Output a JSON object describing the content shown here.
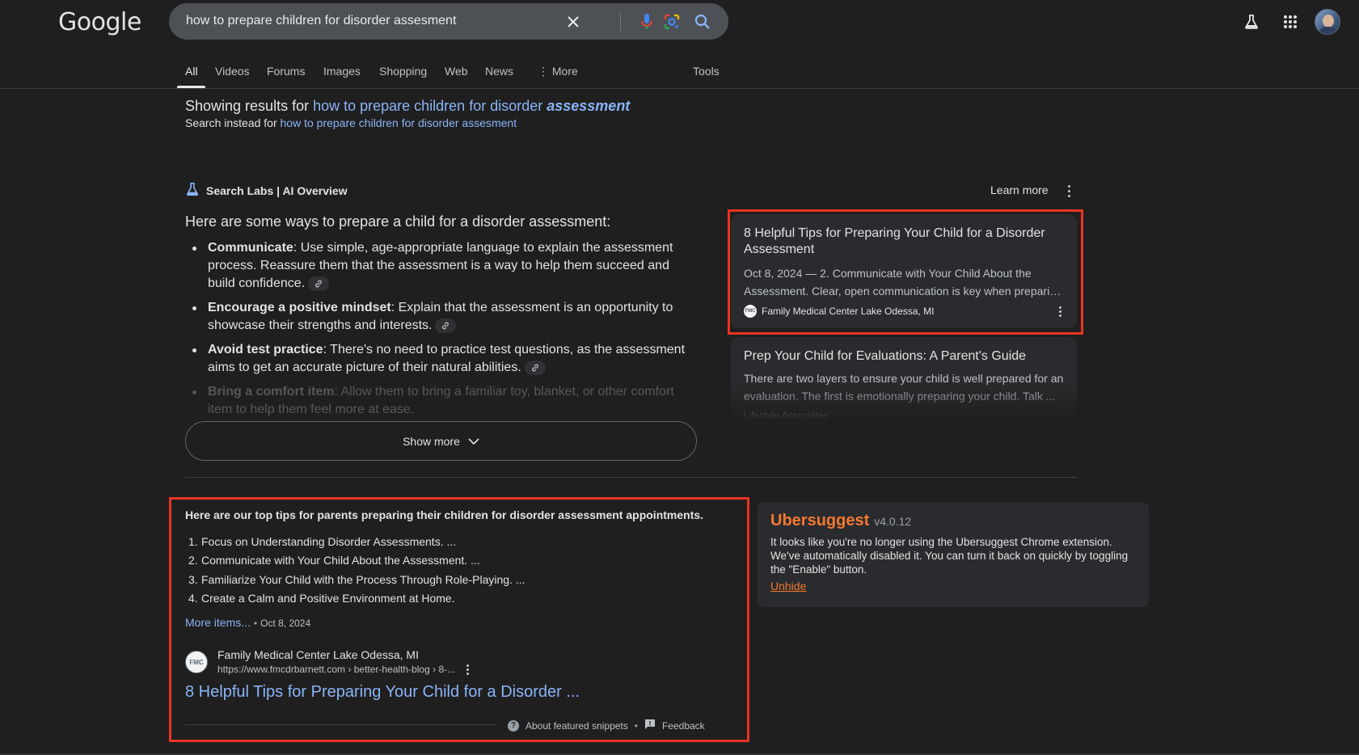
{
  "header": {
    "logo": "Google",
    "search_query": "how to prepare children for disorder assesment"
  },
  "tabs": [
    {
      "label": "All"
    },
    {
      "label": "Videos"
    },
    {
      "label": "Forums"
    },
    {
      "label": "Images"
    },
    {
      "label": "Shopping"
    },
    {
      "label": "Web"
    },
    {
      "label": "News"
    },
    {
      "label": "More"
    },
    {
      "label": "Tools"
    }
  ],
  "spelling": {
    "showing_prefix": "Showing results for ",
    "corrected_plain": "how to prepare children for disorder ",
    "corrected_bold": "assessment",
    "instead_prefix": "Search instead for ",
    "instead_query": "how to prepare children for disorder assesment"
  },
  "ai_overview": {
    "label": "Search Labs | AI Overview",
    "learn_more": "Learn more",
    "heading": "Here are some ways to prepare a child for a disorder assessment:",
    "items": [
      {
        "bold": "Communicate",
        "text": ": Use simple, age-appropriate language to explain the assessment process. Reassure them that the assessment is a way to help them succeed and build confidence."
      },
      {
        "bold": "Encourage a positive mindset",
        "text": ": Explain that the assessment is an opportunity to showcase their strengths and interests."
      },
      {
        "bold": "Avoid test practice",
        "text": ": There's no need to practice test questions, as the assessment aims to get an accurate picture of their natural abilities."
      },
      {
        "bold": "Bring a comfort item",
        "text": ": Allow them to bring a familiar toy, blanket, or other comfort item to help them feel more at ease."
      }
    ],
    "show_more": "Show more",
    "sources": [
      {
        "title": "8 Helpful Tips for Preparing Your Child for a Disorder Assessment",
        "snippet_line1": "Oct 8, 2024 — 2. Communicate with Your Child About the",
        "snippet_line2": "Assessment. Clear, open communication is key when preparin...",
        "site": "Family Medical Center Lake Odessa, MI",
        "favicon_text": "FMC"
      },
      {
        "title": "Prep Your Child for Evaluations: A Parent's Guide",
        "snippet_line1": "There are two layers to ensure your child is well prepared for an",
        "snippet_line2": "evaluation. The first is emotionally preparing your child. Talk ...",
        "site": "Lifestyle Associates"
      }
    ]
  },
  "featured_snippet": {
    "heading": "Here are our top tips for parents preparing their children for disorder assessment appointments.",
    "items": [
      "Focus on Understanding Disorder Assessments. ...",
      "Communicate with Your Child About the Assessment. ...",
      "Familiarize Your Child with the Process Through Role-Playing. ...",
      "Create a Calm and Positive Environment at Home."
    ],
    "more_items": "More items...",
    "date": "Oct 8, 2024",
    "site_name": "Family Medical Center Lake Odessa, MI",
    "url": "https://www.fmcdrbarnett.com › better-health-blog › 8-...",
    "favicon_text": "FMC",
    "title": "8 Helpful Tips for Preparing Your Child for a Disorder ...",
    "about": "About featured snippets",
    "feedback": "Feedback"
  },
  "ubersuggest": {
    "brand": "Ubersuggest",
    "version": "v4.0.12",
    "message": "It looks like you're no longer using the Ubersuggest Chrome extension. We've automatically disabled it. You can turn it back on quickly by toggling the \"Enable\" button.",
    "unhide": "Unhide"
  },
  "colors": {
    "background": "#1f1f1f",
    "link": "#8ab4f8",
    "highlight_border": "#ea3323",
    "ubersuggest_orange": "#f4782f"
  }
}
